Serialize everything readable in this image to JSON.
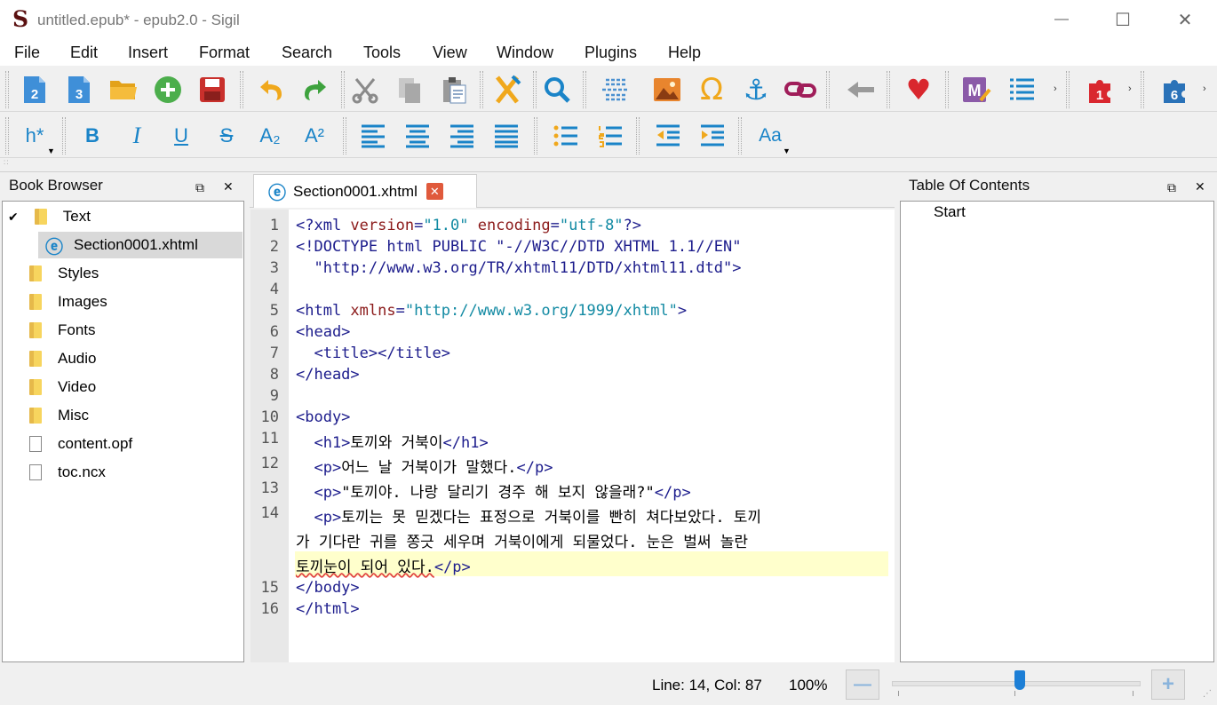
{
  "window": {
    "title": "untitled.epub* - epub2.0 - Sigil",
    "logo_glyph": "S",
    "minimize_glyph": "—",
    "maximize_glyph": "☐",
    "close_glyph": "✕"
  },
  "menu": [
    "File",
    "Edit",
    "Insert",
    "Format",
    "Search",
    "Tools",
    "View",
    "Window",
    "Plugins",
    "Help"
  ],
  "toolbar1": {
    "icons": [
      "new-epub2-icon",
      "new-epub3-icon",
      "open-folder-icon",
      "add-file-icon",
      "save-icon",
      "undo-icon",
      "redo-icon",
      "cut-icon",
      "copy-icon",
      "paste-icon",
      "clean-source-icon",
      "find-replace-icon",
      "insert-split-icon",
      "insert-image-icon",
      "special-char-icon",
      "anchor-icon",
      "link-icon",
      "back-icon",
      "donate-icon",
      "meta-editor-icon",
      "toc-edit-icon",
      "plugin-1-icon",
      "plugin-6-icon"
    ],
    "plugin1_badge": "1",
    "plugin6_badge": "6",
    "new2_badge": "2",
    "new3_badge": "3",
    "meta_badge": "M",
    "chevron": "›"
  },
  "toolbar2": {
    "heading_label": "h*",
    "bold_label": "B",
    "italic_label": "I",
    "underline_label": "U",
    "strike_label": "S",
    "subscript_label": "A₂",
    "superscript_label": "A²",
    "case_label": "Aa"
  },
  "book_browser": {
    "title": "Book Browser",
    "items": [
      {
        "label": "Text",
        "type": "folder",
        "expanded": true
      },
      {
        "label": "Section0001.xhtml",
        "type": "xhtml",
        "selected": true
      },
      {
        "label": "Styles",
        "type": "folder"
      },
      {
        "label": "Images",
        "type": "folder"
      },
      {
        "label": "Fonts",
        "type": "folder"
      },
      {
        "label": "Audio",
        "type": "folder"
      },
      {
        "label": "Video",
        "type": "folder"
      },
      {
        "label": "Misc",
        "type": "folder"
      },
      {
        "label": "content.opf",
        "type": "file"
      },
      {
        "label": "toc.ncx",
        "type": "file"
      }
    ]
  },
  "editor": {
    "tab_label": "Section0001.xhtml",
    "line_numbers": [
      "1",
      "2",
      "3",
      "4",
      "5",
      "6",
      "7",
      "8",
      "9",
      "10",
      "11",
      "12",
      "13",
      "14",
      "15",
      "16"
    ],
    "lines": {
      "l1": {
        "a": "<?xml ",
        "b": "version",
        "c": "=",
        "d": "\"1.0\"",
        "e": " encoding",
        "f": "=",
        "g": "\"utf-8\"",
        "h": "?>"
      },
      "l2": "<!DOCTYPE html PUBLIC \"-//W3C//DTD XHTML 1.1//EN\"",
      "l3": "  \"http://www.w3.org/TR/xhtml11/DTD/xhtml11.dtd\">",
      "l5": {
        "a": "<html ",
        "b": "xmlns",
        "c": "=",
        "d": "\"http://www.w3.org/1999/xhtml\"",
        "e": ">"
      },
      "l6": "<head>",
      "l7": "  <title></title>",
      "l8": "</head>",
      "l10": "<body>",
      "l11": {
        "open": "  <h1>",
        "text": "토끼와 거북이",
        "close": "</h1>"
      },
      "l12": {
        "open": "  <p>",
        "text": "어느 날 거북이가 말했다.",
        "close": "</p>"
      },
      "l13": {
        "open": "  <p>",
        "text": "\"토끼야. 나랑 달리기 경주 해 보지 않을래?\"",
        "close": "</p>"
      },
      "l14a": {
        "open": "  <p>",
        "text": "토끼는 못 믿겠다는 표정으로 거북이를 빤히 쳐다보았다. 토끼"
      },
      "l14b": "가 기다란 귀를 쫑긋 세우며 거북이에게 되물었다. 눈은 벌써 놀란",
      "l14c": {
        "text": "토끼눈이 되어 있다.",
        "close": "</p>"
      },
      "l15": "</body>",
      "l16": "</html>"
    }
  },
  "toc": {
    "title": "Table Of Contents",
    "items": [
      "Start"
    ]
  },
  "status": {
    "position": "Line: 14, Col: 87",
    "zoom": "100%",
    "zoom_out": "—",
    "zoom_in": "+",
    "zoom_slider_fraction": 0.5
  },
  "colors": {
    "tag": "#1c1c8c",
    "attr": "#8b1a1a",
    "value": "#128aa3",
    "icon_blue": "#1a84c8",
    "highlight": "#ffffcc"
  }
}
